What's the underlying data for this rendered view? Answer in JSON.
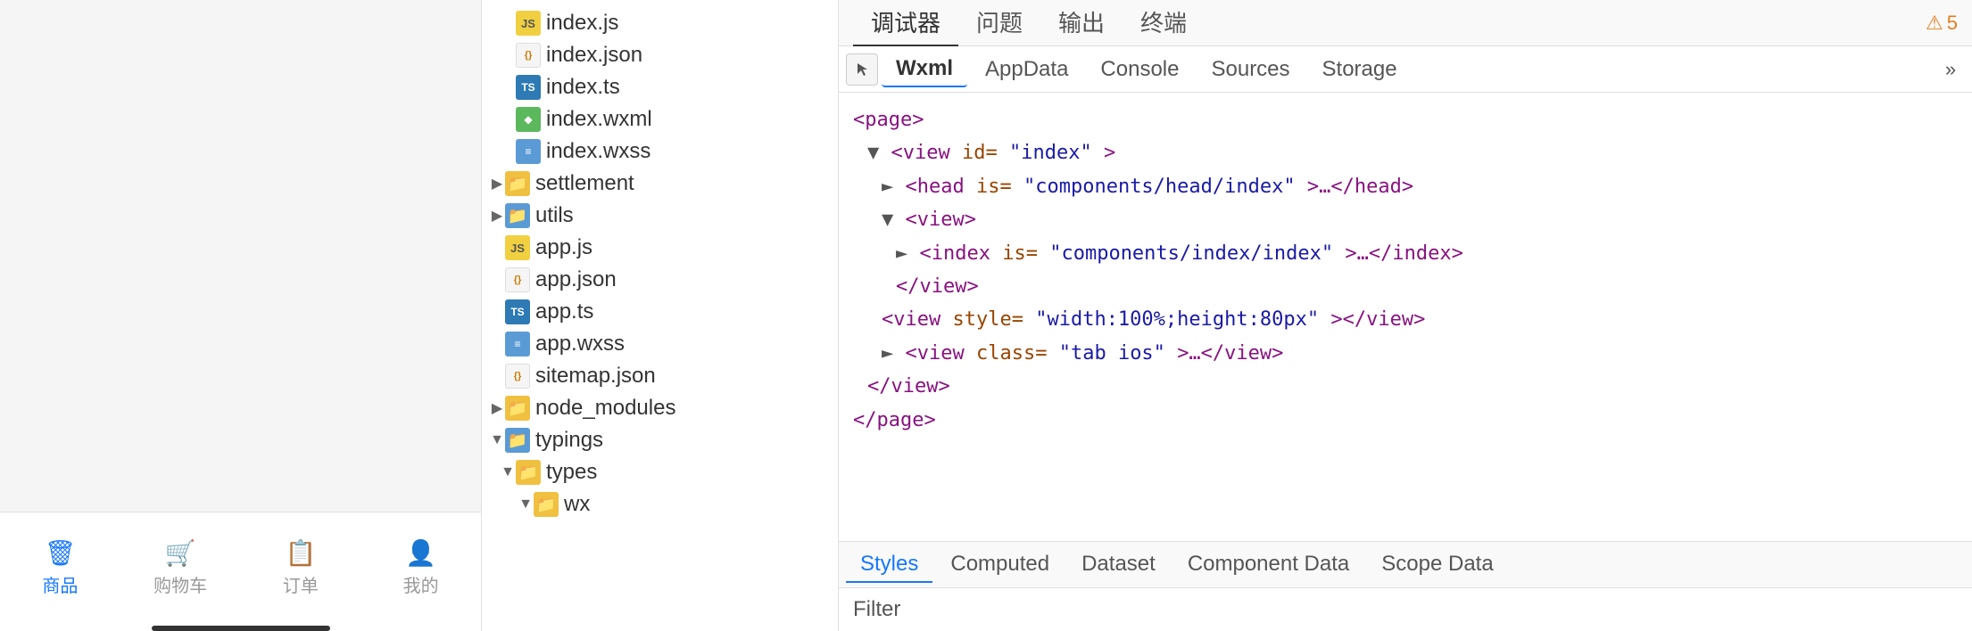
{
  "mobile": {
    "tabs": [
      {
        "id": "goods",
        "label": "商品",
        "icon": "🗑",
        "active": true
      },
      {
        "id": "cart",
        "label": "购物车",
        "icon": "🛒",
        "active": false
      },
      {
        "id": "orders",
        "label": "订单",
        "icon": "📋",
        "active": false
      },
      {
        "id": "mine",
        "label": "我的",
        "icon": "👤",
        "active": false
      }
    ]
  },
  "filetree": {
    "items": [
      {
        "id": "index-js",
        "indent": "indent-1",
        "arrow": "empty",
        "iconType": "js",
        "iconLabel": "JS",
        "name": "index.js"
      },
      {
        "id": "index-json",
        "indent": "indent-1",
        "arrow": "empty",
        "iconType": "json",
        "iconLabel": "{}",
        "name": "index.json"
      },
      {
        "id": "index-ts",
        "indent": "indent-1",
        "arrow": "empty",
        "iconType": "ts",
        "iconLabel": "TS",
        "name": "index.ts"
      },
      {
        "id": "index-wxml",
        "indent": "indent-1",
        "arrow": "empty",
        "iconType": "wxml",
        "iconLabel": "◆",
        "name": "index.wxml"
      },
      {
        "id": "index-wxss",
        "indent": "indent-1",
        "arrow": "empty",
        "iconType": "wxss",
        "iconLabel": "≡",
        "name": "index.wxss"
      },
      {
        "id": "settlement",
        "indent": "indent-0",
        "arrow": "closed",
        "iconType": "folder",
        "iconLabel": "📁",
        "name": "settlement"
      },
      {
        "id": "utils",
        "indent": "indent-0",
        "arrow": "closed",
        "iconType": "folder-special",
        "iconLabel": "📁",
        "name": "utils"
      },
      {
        "id": "app-js",
        "indent": "indent-0",
        "arrow": "empty",
        "iconType": "js",
        "iconLabel": "JS",
        "name": "app.js"
      },
      {
        "id": "app-json",
        "indent": "indent-0",
        "arrow": "empty",
        "iconType": "json",
        "iconLabel": "{}",
        "name": "app.json"
      },
      {
        "id": "app-ts",
        "indent": "indent-0",
        "arrow": "empty",
        "iconType": "ts",
        "iconLabel": "TS",
        "name": "app.ts"
      },
      {
        "id": "app-wxss",
        "indent": "indent-0",
        "arrow": "empty",
        "iconType": "wxss",
        "iconLabel": "≡",
        "name": "app.wxss"
      },
      {
        "id": "sitemap-json",
        "indent": "indent-0",
        "arrow": "empty",
        "iconType": "json",
        "iconLabel": "{}",
        "name": "sitemap.json"
      },
      {
        "id": "node-modules",
        "indent": "indent-0",
        "arrow": "closed",
        "iconType": "folder",
        "iconLabel": "📁",
        "name": "node_modules"
      },
      {
        "id": "typings",
        "indent": "indent-0",
        "arrow": "open",
        "iconType": "folder-special",
        "iconLabel": "📁",
        "name": "typings"
      },
      {
        "id": "types",
        "indent": "indent-1",
        "arrow": "open",
        "iconType": "folder",
        "iconLabel": "📁",
        "name": "types"
      },
      {
        "id": "wx",
        "indent": "indent-2",
        "arrow": "open",
        "iconType": "folder",
        "iconLabel": "📁",
        "name": "wx"
      }
    ]
  },
  "devtools": {
    "top_tabs": [
      {
        "id": "debugger",
        "label": "调试器",
        "active": true
      },
      {
        "id": "issues",
        "label": "问题",
        "active": false
      },
      {
        "id": "output",
        "label": "输出",
        "active": false
      },
      {
        "id": "terminal",
        "label": "终端",
        "active": false
      }
    ],
    "tool_tabs": [
      {
        "id": "wxml",
        "label": "Wxml",
        "active": true
      },
      {
        "id": "appdata",
        "label": "AppData",
        "active": false
      },
      {
        "id": "console",
        "label": "Console",
        "active": false
      },
      {
        "id": "sources",
        "label": "Sources",
        "active": false
      },
      {
        "id": "storage",
        "label": "Storage",
        "active": false
      }
    ],
    "more_btn": "»",
    "warn_count": "▲ 5",
    "xml": {
      "lines": [
        {
          "indent": 0,
          "content": "<page>"
        },
        {
          "indent": 1,
          "content": "▼ <view id=\"index\">"
        },
        {
          "indent": 2,
          "content": "► <head is=\"components/head/index\">…</head>"
        },
        {
          "indent": 2,
          "content": "▼ <view>"
        },
        {
          "indent": 3,
          "content": "► <index is=\"components/index/index\">…</index>"
        },
        {
          "indent": 3,
          "content": "</view>"
        },
        {
          "indent": 2,
          "content": "<view style=\"width:100%;height:80px\"></view>"
        },
        {
          "indent": 2,
          "content": "► <view class=\"tab ios\">…</view>"
        },
        {
          "indent": 1,
          "content": "</view>"
        },
        {
          "indent": 0,
          "content": "</page>"
        }
      ]
    },
    "bottom_tabs": [
      {
        "id": "styles",
        "label": "Styles",
        "active": true
      },
      {
        "id": "computed",
        "label": "Computed",
        "active": false
      },
      {
        "id": "dataset",
        "label": "Dataset",
        "active": false
      },
      {
        "id": "component-data",
        "label": "Component Data",
        "active": false
      },
      {
        "id": "scope-data",
        "label": "Scope Data",
        "active": false
      }
    ],
    "filter_label": "Filter"
  }
}
